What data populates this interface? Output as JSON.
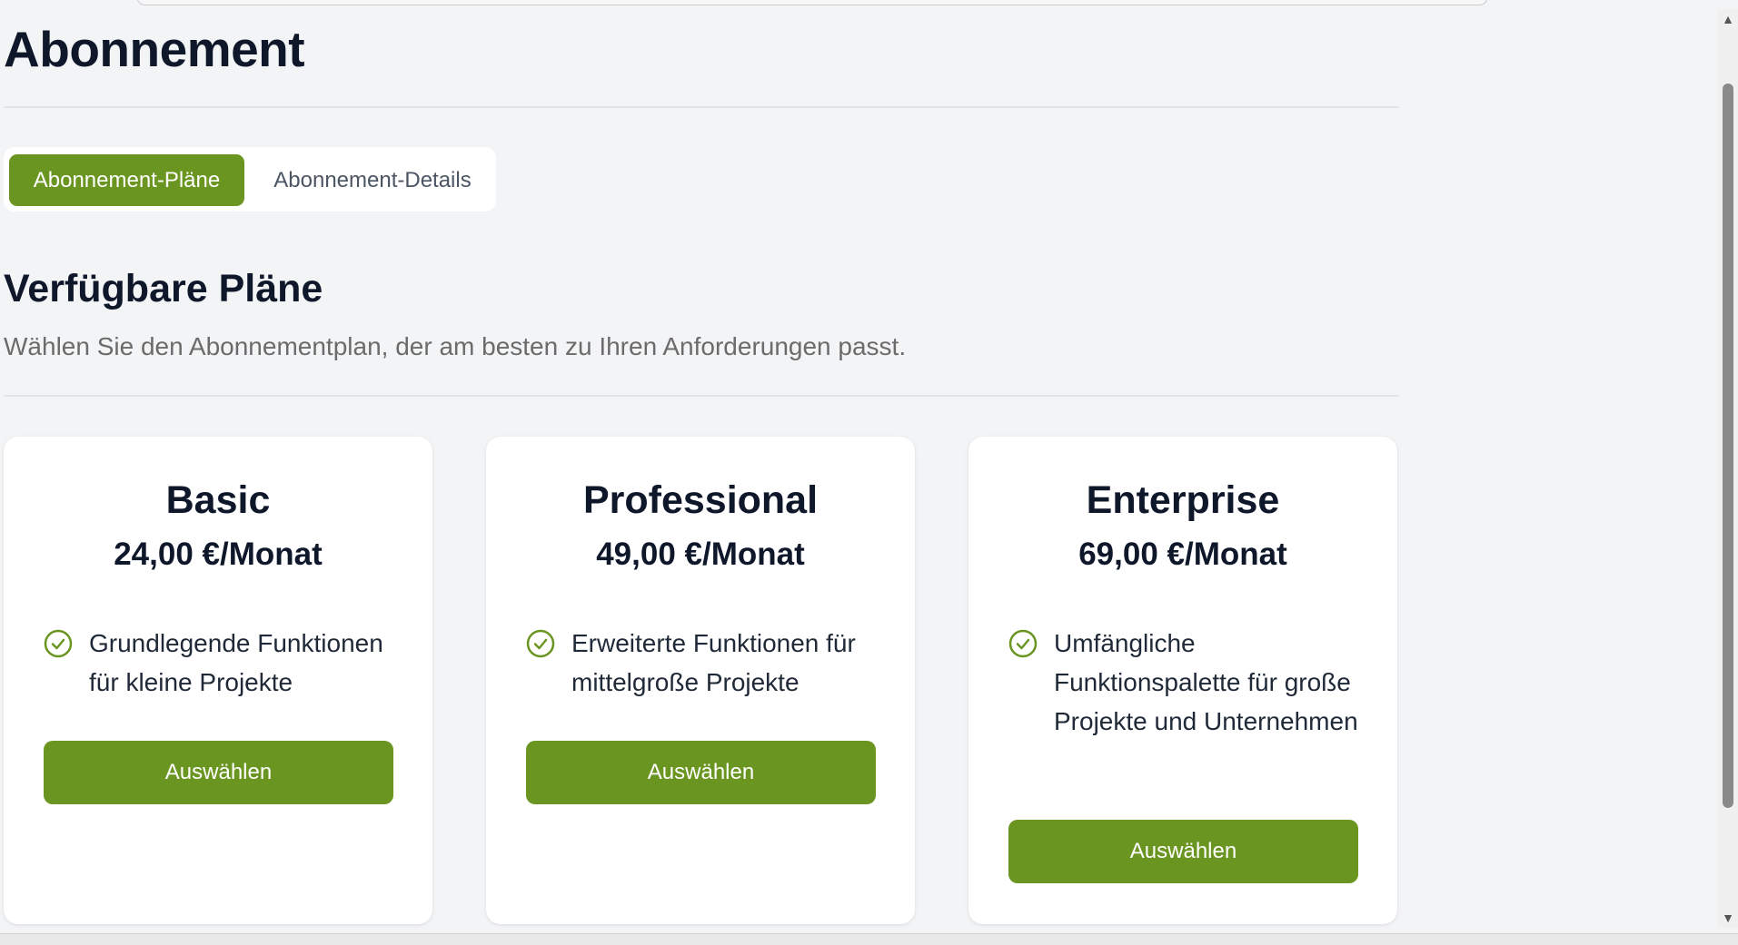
{
  "page": {
    "title": "Abonnement"
  },
  "tabs": [
    {
      "label": "Abonnement-Pläne",
      "active": true
    },
    {
      "label": "Abonnement-Details",
      "active": false
    }
  ],
  "section": {
    "title": "Verfügbare Pläne",
    "subtitle": "Wählen Sie den Abonnementplan, der am besten zu Ihren Anforderungen passt."
  },
  "plans": [
    {
      "name": "Basic",
      "price": "24,00 €/Monat",
      "feature": "Grundlegende Funktionen für kleine Projekte",
      "button": "Auswählen"
    },
    {
      "name": "Professional",
      "price": "49,00 €/Monat",
      "feature": "Erweiterte Funktionen für mittelgroße Projekte",
      "button": "Auswählen"
    },
    {
      "name": "Enterprise",
      "price": "69,00 €/Monat",
      "feature": "Umfängliche Funktionspalette für große Projekte und Unternehmen",
      "button": "Auswählen"
    }
  ],
  "icons": {
    "feature": "check-circle-icon",
    "scroll_up": "triangle-up-icon",
    "scroll_down": "triangle-down-icon"
  },
  "colors": {
    "accent": "#6b9521",
    "background": "#f3f4f6",
    "card": "#ffffff",
    "heading": "#0f172a",
    "muted": "#6b6b6b"
  }
}
